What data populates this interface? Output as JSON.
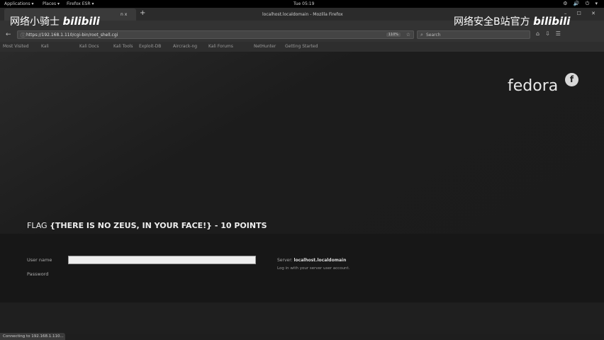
{
  "gnome": {
    "applications": "Applications ▾",
    "places": "Places ▾",
    "firefox": "Firefox ESR ▾",
    "clock": "Tue 05:19",
    "tray": "⚙ 🔊 ⏻ ▾"
  },
  "window": {
    "title": "localhost.localdomain - Mozilla Firefox",
    "tab_title": "n x",
    "new_tab": "+",
    "controls": "– ☐ ✕"
  },
  "nav": {
    "back": "←",
    "url": "https://192.168.1.110/cgi-bin/root_shell.cgi",
    "zoom": "110%",
    "search_placeholder": "Search"
  },
  "bookmarks": {
    "items": [
      "Most Visited",
      "Kali",
      "Kali Docs",
      "Kali Tools",
      "Exploit-DB",
      "Aircrack-ng",
      "Kali Forums",
      "NetHunter",
      "Getting Started"
    ]
  },
  "watermark": {
    "left_text": "网络小骑士",
    "left_brand": "bilibili",
    "right_text": "网络安全B站官方",
    "right_brand": "bilibili"
  },
  "page": {
    "logo": "fedora",
    "logo_mark": "f",
    "flag_prefix": "FLAG ",
    "flag_text": "{THERE IS NO ZEUS, IN YOUR FACE!} - 10 POINTS",
    "username_label": "User name",
    "password_label": "Password",
    "username_value": "",
    "server_label": "Server: ",
    "server_value": "localhost.localdomain",
    "hint": "Log in with your server user account."
  },
  "status": {
    "text": "Connecting to 192.168.1.110..."
  }
}
